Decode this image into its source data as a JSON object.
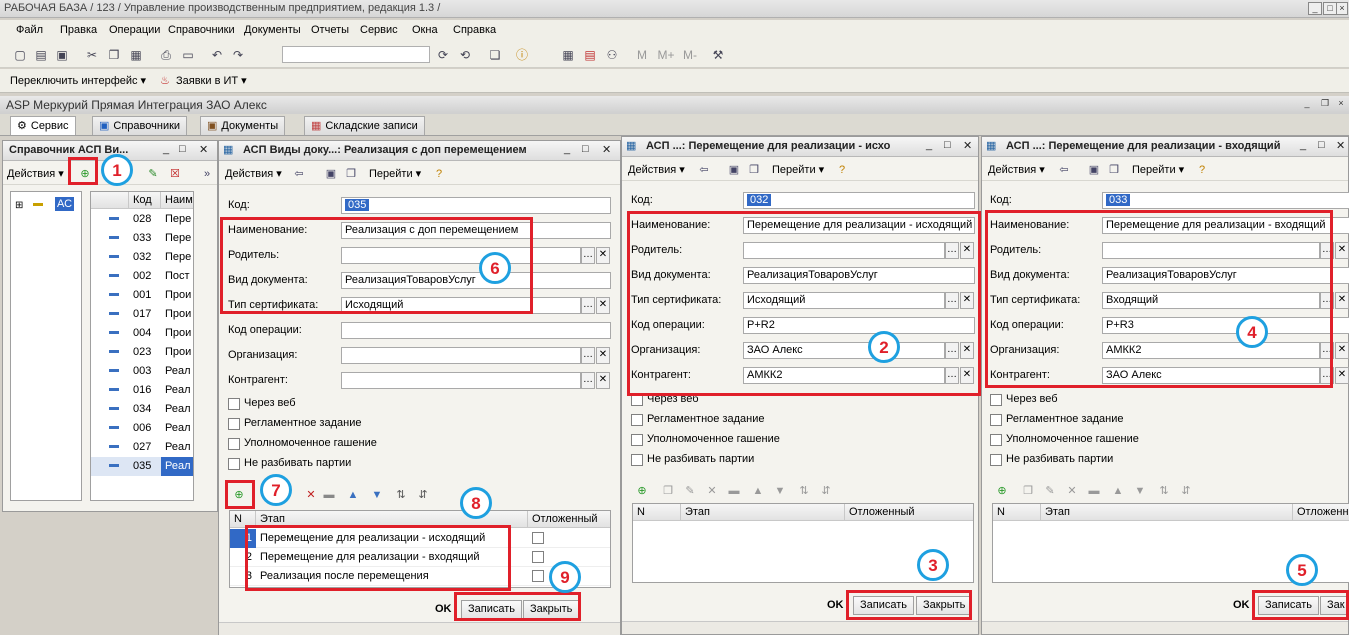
{
  "window_title": "РАБОЧАЯ БАЗА / 123 /  Управление производственным предприятием, редакция 1.3 /",
  "menu": [
    "Файл",
    "Правка",
    "Операции",
    "Справочники",
    "Документы",
    "Отчеты",
    "Сервис",
    "Окна",
    "Справка"
  ],
  "toolbar2": {
    "switch_interface": "Переключить интерфейс ▾",
    "it_requests": "Заявки в ИТ ▾"
  },
  "toolbar_letters": [
    "M",
    "M+",
    "M-"
  ],
  "app_title": "ASP Меркурий Прямая Интеграция ЗАО Алекс",
  "tabs": [
    {
      "label": "Сервис",
      "icon": "gear-icon"
    },
    {
      "label": "Справочники",
      "icon": "book-icon"
    },
    {
      "label": "Документы",
      "icon": "briefcase-icon"
    },
    {
      "label": "Складские записи",
      "icon": "blocks-icon"
    }
  ],
  "panel1": {
    "title": "Справочник АСП Ви...",
    "actions": "Действия ▾",
    "tree_item": "АС",
    "grid_headers": [
      "Код",
      "Наим"
    ],
    "rows": [
      {
        "code": "028",
        "name": "Пере"
      },
      {
        "code": "033",
        "name": "Пере"
      },
      {
        "code": "032",
        "name": "Пере"
      },
      {
        "code": "002",
        "name": "Пост"
      },
      {
        "code": "001",
        "name": "Прои"
      },
      {
        "code": "017",
        "name": "Прои"
      },
      {
        "code": "004",
        "name": "Прои"
      },
      {
        "code": "023",
        "name": "Прои"
      },
      {
        "code": "003",
        "name": "Реал"
      },
      {
        "code": "016",
        "name": "Реал"
      },
      {
        "code": "034",
        "name": "Реал"
      },
      {
        "code": "006",
        "name": "Реал"
      },
      {
        "code": "027",
        "name": "Реал"
      },
      {
        "code": "035",
        "name": "Реал"
      }
    ]
  },
  "panel2": {
    "title": "АСП Виды доку...: Реализация с доп перемещением",
    "actions": "Действия ▾",
    "goto": "Перейти ▾",
    "labels": {
      "code": "Код:",
      "name": "Наименование:",
      "parent": "Родитель:",
      "doc_type": "Вид документа:",
      "cert_type": "Тип сертификата:",
      "op_code": "Код операции:",
      "org": "Организация:",
      "contractor": "Контрагент:"
    },
    "values": {
      "code": "035",
      "name": "Реализация с доп перемещением",
      "parent": "",
      "doc_type": "РеализацияТоваровУслуг",
      "cert_type": "Исходящий",
      "op_code": "",
      "org": "",
      "contractor": ""
    },
    "checkboxes": [
      "Через веб",
      "Регламентное задание",
      "Уполномоченное гашение",
      "Не разбивать партии"
    ],
    "grid_headers": [
      "N",
      "Этап",
      "Отложенный"
    ],
    "grid_rows": [
      {
        "n": "1",
        "stage": "Перемещение для реализации - исходящий"
      },
      {
        "n": "2",
        "stage": "Перемещение для реализации - входящий"
      },
      {
        "n": "3",
        "stage": "Реализация после перемещения"
      }
    ],
    "ok": "OK",
    "save": "Записать",
    "close": "Закрыть"
  },
  "panel3": {
    "title": "АСП ...: Перемещение для реализации - исхо",
    "actions": "Действия ▾",
    "goto": "Перейти ▾",
    "labels": {
      "code": "Код:",
      "name": "Наименование:",
      "parent": "Родитель:",
      "doc_type": "Вид документа:",
      "cert_type": "Тип сертификата:",
      "op_code": "Код операции:",
      "org": "Организация:",
      "contractor": "Контрагент:"
    },
    "values": {
      "code": "032",
      "name": "Перемещение для реализации - исходящий",
      "parent": "",
      "doc_type": "РеализацияТоваровУслуг",
      "cert_type": "Исходящий",
      "op_code": "P+R2",
      "org": "ЗАО Алекс",
      "contractor": "АМКК2"
    },
    "checkboxes": [
      "Через веб",
      "Регламентное задание",
      "Уполномоченное гашение",
      "Не разбивать партии"
    ],
    "grid_headers": [
      "N",
      "Этап",
      "Отложенный"
    ],
    "ok": "OK",
    "save": "Записать",
    "close": "Закрыть"
  },
  "panel4": {
    "title": "АСП ...: Перемещение для реализации - входящий",
    "actions": "Действия ▾",
    "goto": "Перейти ▾",
    "labels": {
      "code": "Код:",
      "name": "Наименование:",
      "parent": "Родитель:",
      "doc_type": "Вид документа:",
      "cert_type": "Тип сертификата:",
      "op_code": "Код операции:",
      "org": "Организация:",
      "contractor": "Контрагент:"
    },
    "values": {
      "code": "033",
      "name": "Перемещение для реализации - входящий",
      "parent": "",
      "doc_type": "РеализацияТоваровУслуг",
      "cert_type": "Входящий",
      "op_code": "P+R3",
      "org": "АМКК2",
      "contractor": "ЗАО Алекс"
    },
    "checkboxes": [
      "Через веб",
      "Регламентное задание",
      "Уполномоченное гашение",
      "Не разбивать партии"
    ],
    "grid_headers": [
      "N",
      "Этап",
      "Отложенный"
    ],
    "ok": "OK",
    "save": "Записать",
    "close": "Зак"
  },
  "annotations": [
    "1",
    "2",
    "3",
    "4",
    "5",
    "6",
    "7",
    "8",
    "9"
  ],
  "colors": {
    "highlight_red": "#e0202a",
    "circle_blue": "#1ea0e0",
    "selection": "#3169c6"
  }
}
